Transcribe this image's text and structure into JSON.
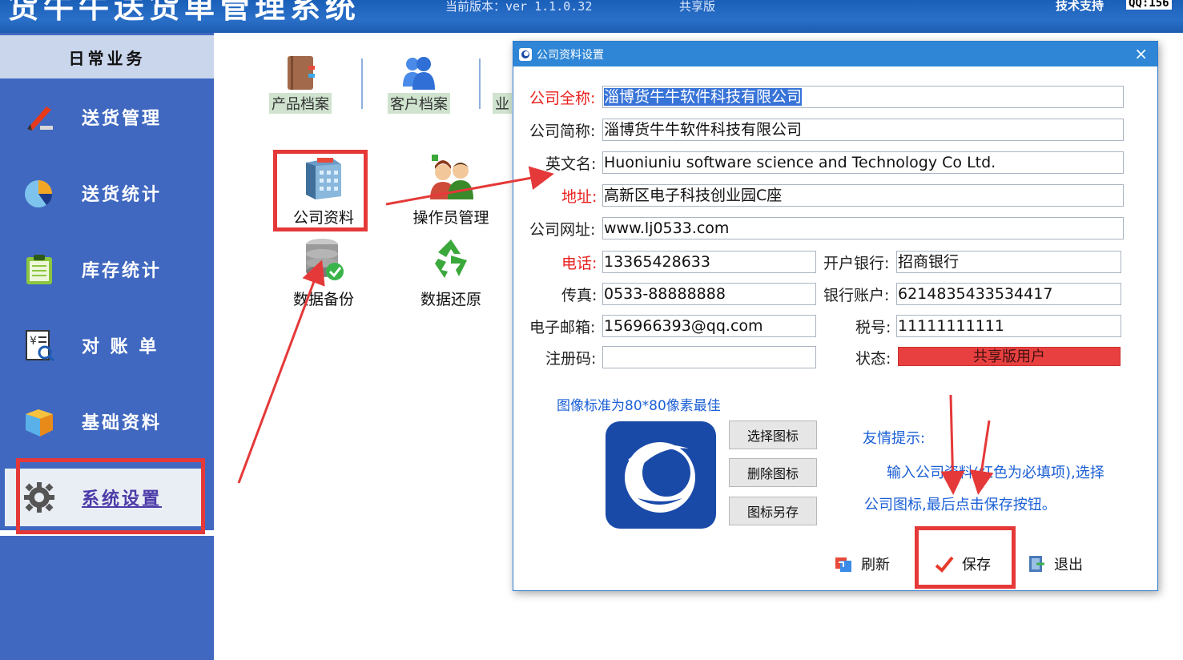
{
  "app": {
    "title": "货牛牛送货单管理系统",
    "version": "当前版本：ver 1.1.0.32",
    "edition": "共享版",
    "support": "技术支持",
    "qq": "QQ:156"
  },
  "sidebar": {
    "header": "日常业务",
    "items": [
      {
        "label": "送货管理",
        "icon": "pen-icon"
      },
      {
        "label": "送货统计",
        "icon": "pie-chart-icon"
      },
      {
        "label": "库存统计",
        "icon": "clipboard-icon"
      },
      {
        "label": "对 账 单",
        "icon": "statement-icon"
      },
      {
        "label": "基础资料",
        "icon": "box-icon"
      },
      {
        "label": "系统设置",
        "icon": "gear-icon"
      }
    ]
  },
  "toolbar": {
    "items": [
      {
        "label": "产品档案",
        "icon": "book-icon"
      },
      {
        "label": "客户档案",
        "icon": "users-icon"
      },
      {
        "label": "业",
        "icon": "partial-icon"
      }
    ]
  },
  "settings_grid": {
    "items": [
      {
        "label": "公司资料",
        "icon": "company-building-icon"
      },
      {
        "label": "操作员管理",
        "icon": "operators-icon"
      },
      {
        "label": "数据备份",
        "icon": "database-check-icon"
      },
      {
        "label": "数据还原",
        "icon": "recycle-icon"
      }
    ]
  },
  "dialog": {
    "title": "公司资料设置",
    "close": "×",
    "fields": {
      "full_name": {
        "label": "公司全称:",
        "value": "淄博货牛牛软件科技有限公司"
      },
      "short_name": {
        "label": "公司简称:",
        "value": "淄博货牛牛软件科技有限公司"
      },
      "english_name": {
        "label": "英文名:",
        "value": "Huoniuniu software science and Technology Co Ltd."
      },
      "address": {
        "label": "地址:",
        "value": "高新区电子科技创业园C座"
      },
      "website": {
        "label": "公司网址:",
        "value": "www.lj0533.com"
      },
      "phone": {
        "label": "电话:",
        "value": "13365428633"
      },
      "bank": {
        "label": "开户银行:",
        "value": "招商银行"
      },
      "fax": {
        "label": "传真:",
        "value": "0533-88888888"
      },
      "account": {
        "label": "银行账户:",
        "value": "6214835433534417"
      },
      "email": {
        "label": "电子邮箱:",
        "value": "156966393@qq.com"
      },
      "tax_no": {
        "label": "税号:",
        "value": "11111111111"
      },
      "reg_code": {
        "label": "注册码:",
        "value": ""
      },
      "status": {
        "label": "状态:",
        "value": "共享版用户"
      }
    },
    "image_hint": "图像标准为80*80像素最佳",
    "buttons": {
      "choose_icon": "选择图标",
      "delete_icon": "删除图标",
      "save_icon_as": "图标另存"
    },
    "tip": {
      "title": "友情提示:",
      "line1": "输入公司资料(红色为必填项),选择",
      "line2": "公司图标,最后点击保存按钮。"
    },
    "footer": {
      "refresh": "刷新",
      "save": "保存",
      "exit": "退出"
    }
  },
  "colors": {
    "required": "#e8201e",
    "highlight": "#e53939",
    "sidebar": "#4068c0",
    "title_bar": "#2f86d6",
    "status_bg": "#e84040",
    "tip_text": "#1a5fd6"
  }
}
